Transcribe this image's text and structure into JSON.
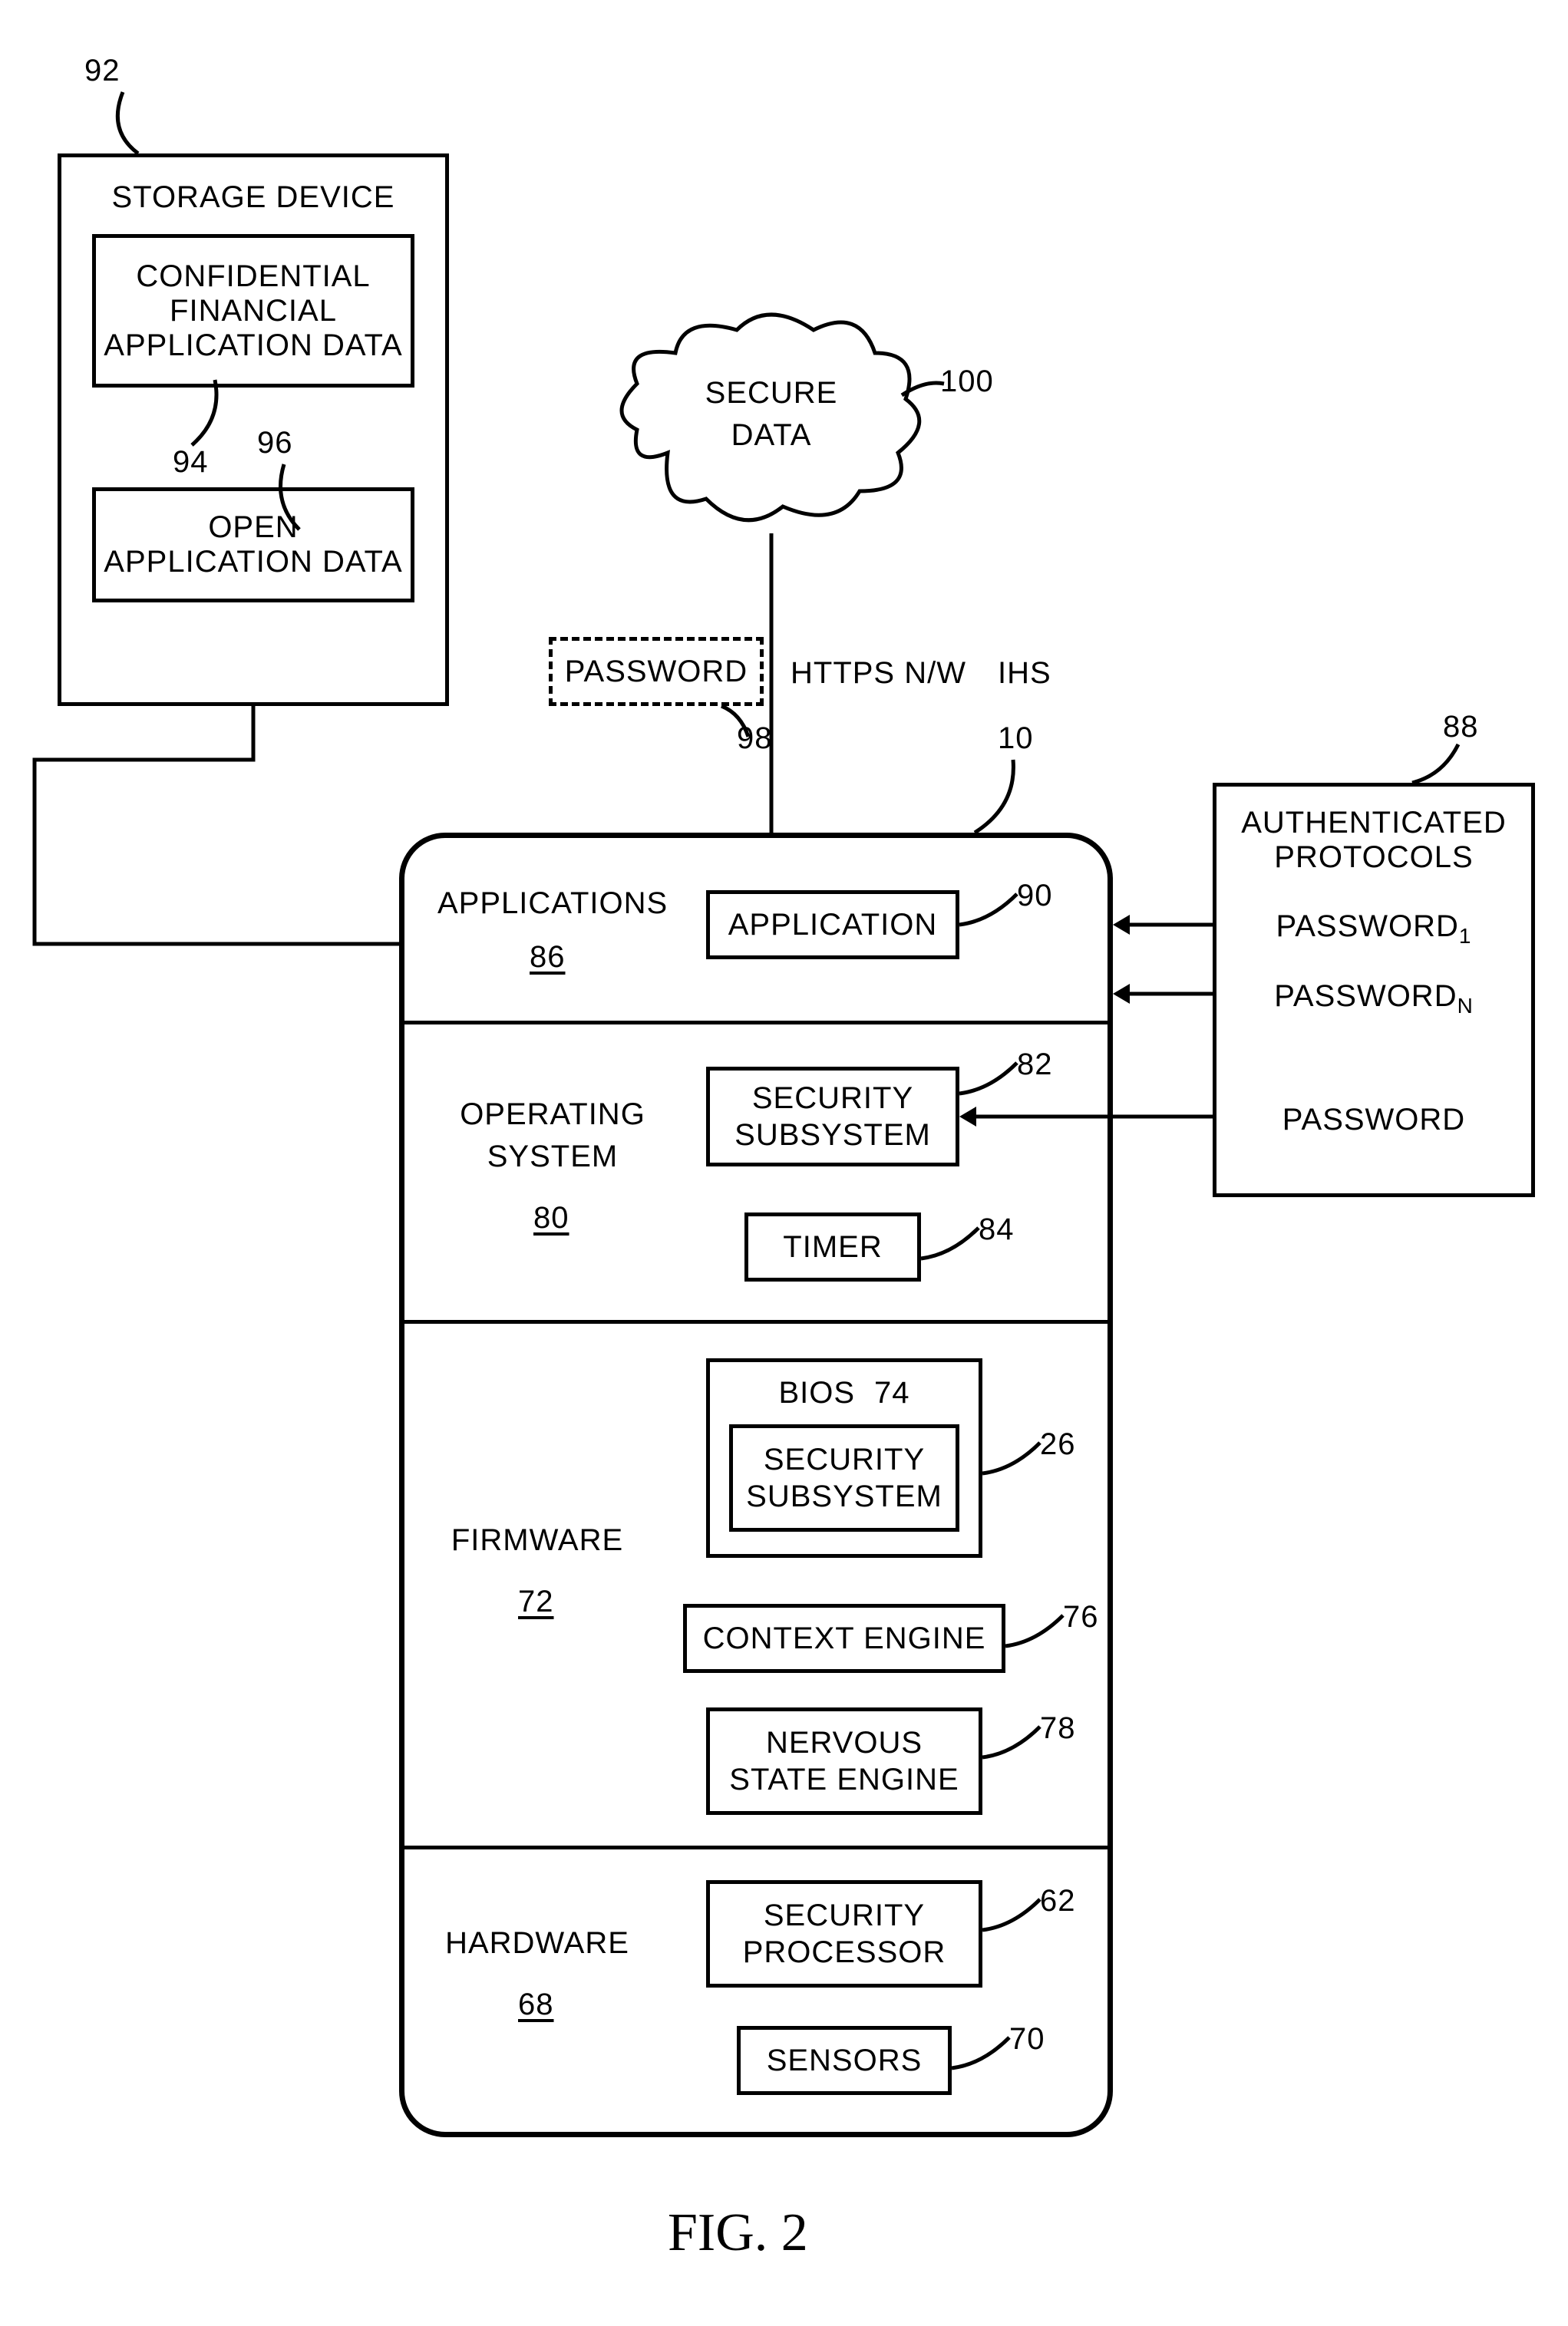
{
  "storage_device": {
    "ref": "92",
    "title": "STORAGE DEVICE",
    "confidential": {
      "line1": "CONFIDENTIAL",
      "line2": "FINANCIAL",
      "line3": "APPLICATION DATA",
      "ref": "94"
    },
    "open": {
      "line1": "OPEN",
      "line2": "APPLICATION DATA",
      "ref": "96"
    }
  },
  "cloud": {
    "line1": "SECURE",
    "line2": "DATA",
    "ref": "100"
  },
  "password_box": {
    "text": "PASSWORD",
    "ref": "98"
  },
  "https_label": "HTTPS N/W",
  "ihs": {
    "label": "IHS",
    "ref": "10"
  },
  "authenticated": {
    "title1": "AUTHENTICATED",
    "title2": "PROTOCOLS",
    "ref": "88",
    "pw1": "PASSWORD",
    "pw1_sub": "1",
    "pwn": "PASSWORD",
    "pwn_sub": "N",
    "pw_single": "PASSWORD"
  },
  "layers": {
    "applications": {
      "title": "APPLICATIONS",
      "ref": "86",
      "app_box": "APPLICATION",
      "app_ref": "90"
    },
    "os": {
      "title1": "OPERATING",
      "title2": "SYSTEM",
      "ref": "80",
      "security": "SECURITY\nSUBSYSTEM",
      "security_ref": "82",
      "timer": "TIMER",
      "timer_ref": "84"
    },
    "firmware": {
      "title": "FIRMWARE",
      "ref": "72",
      "bios_label": "BIOS",
      "bios_ref": "74",
      "bios_box_ref": "26",
      "security": "SECURITY\nSUBSYSTEM",
      "context": "CONTEXT ENGINE",
      "context_ref": "76",
      "nervous": "NERVOUS\nSTATE ENGINE",
      "nervous_ref": "78"
    },
    "hardware": {
      "title": "HARDWARE",
      "ref": "68",
      "secproc": "SECURITY\nPROCESSOR",
      "secproc_ref": "62",
      "sensors": "SENSORS",
      "sensors_ref": "70"
    }
  },
  "figure": "FIG. 2"
}
